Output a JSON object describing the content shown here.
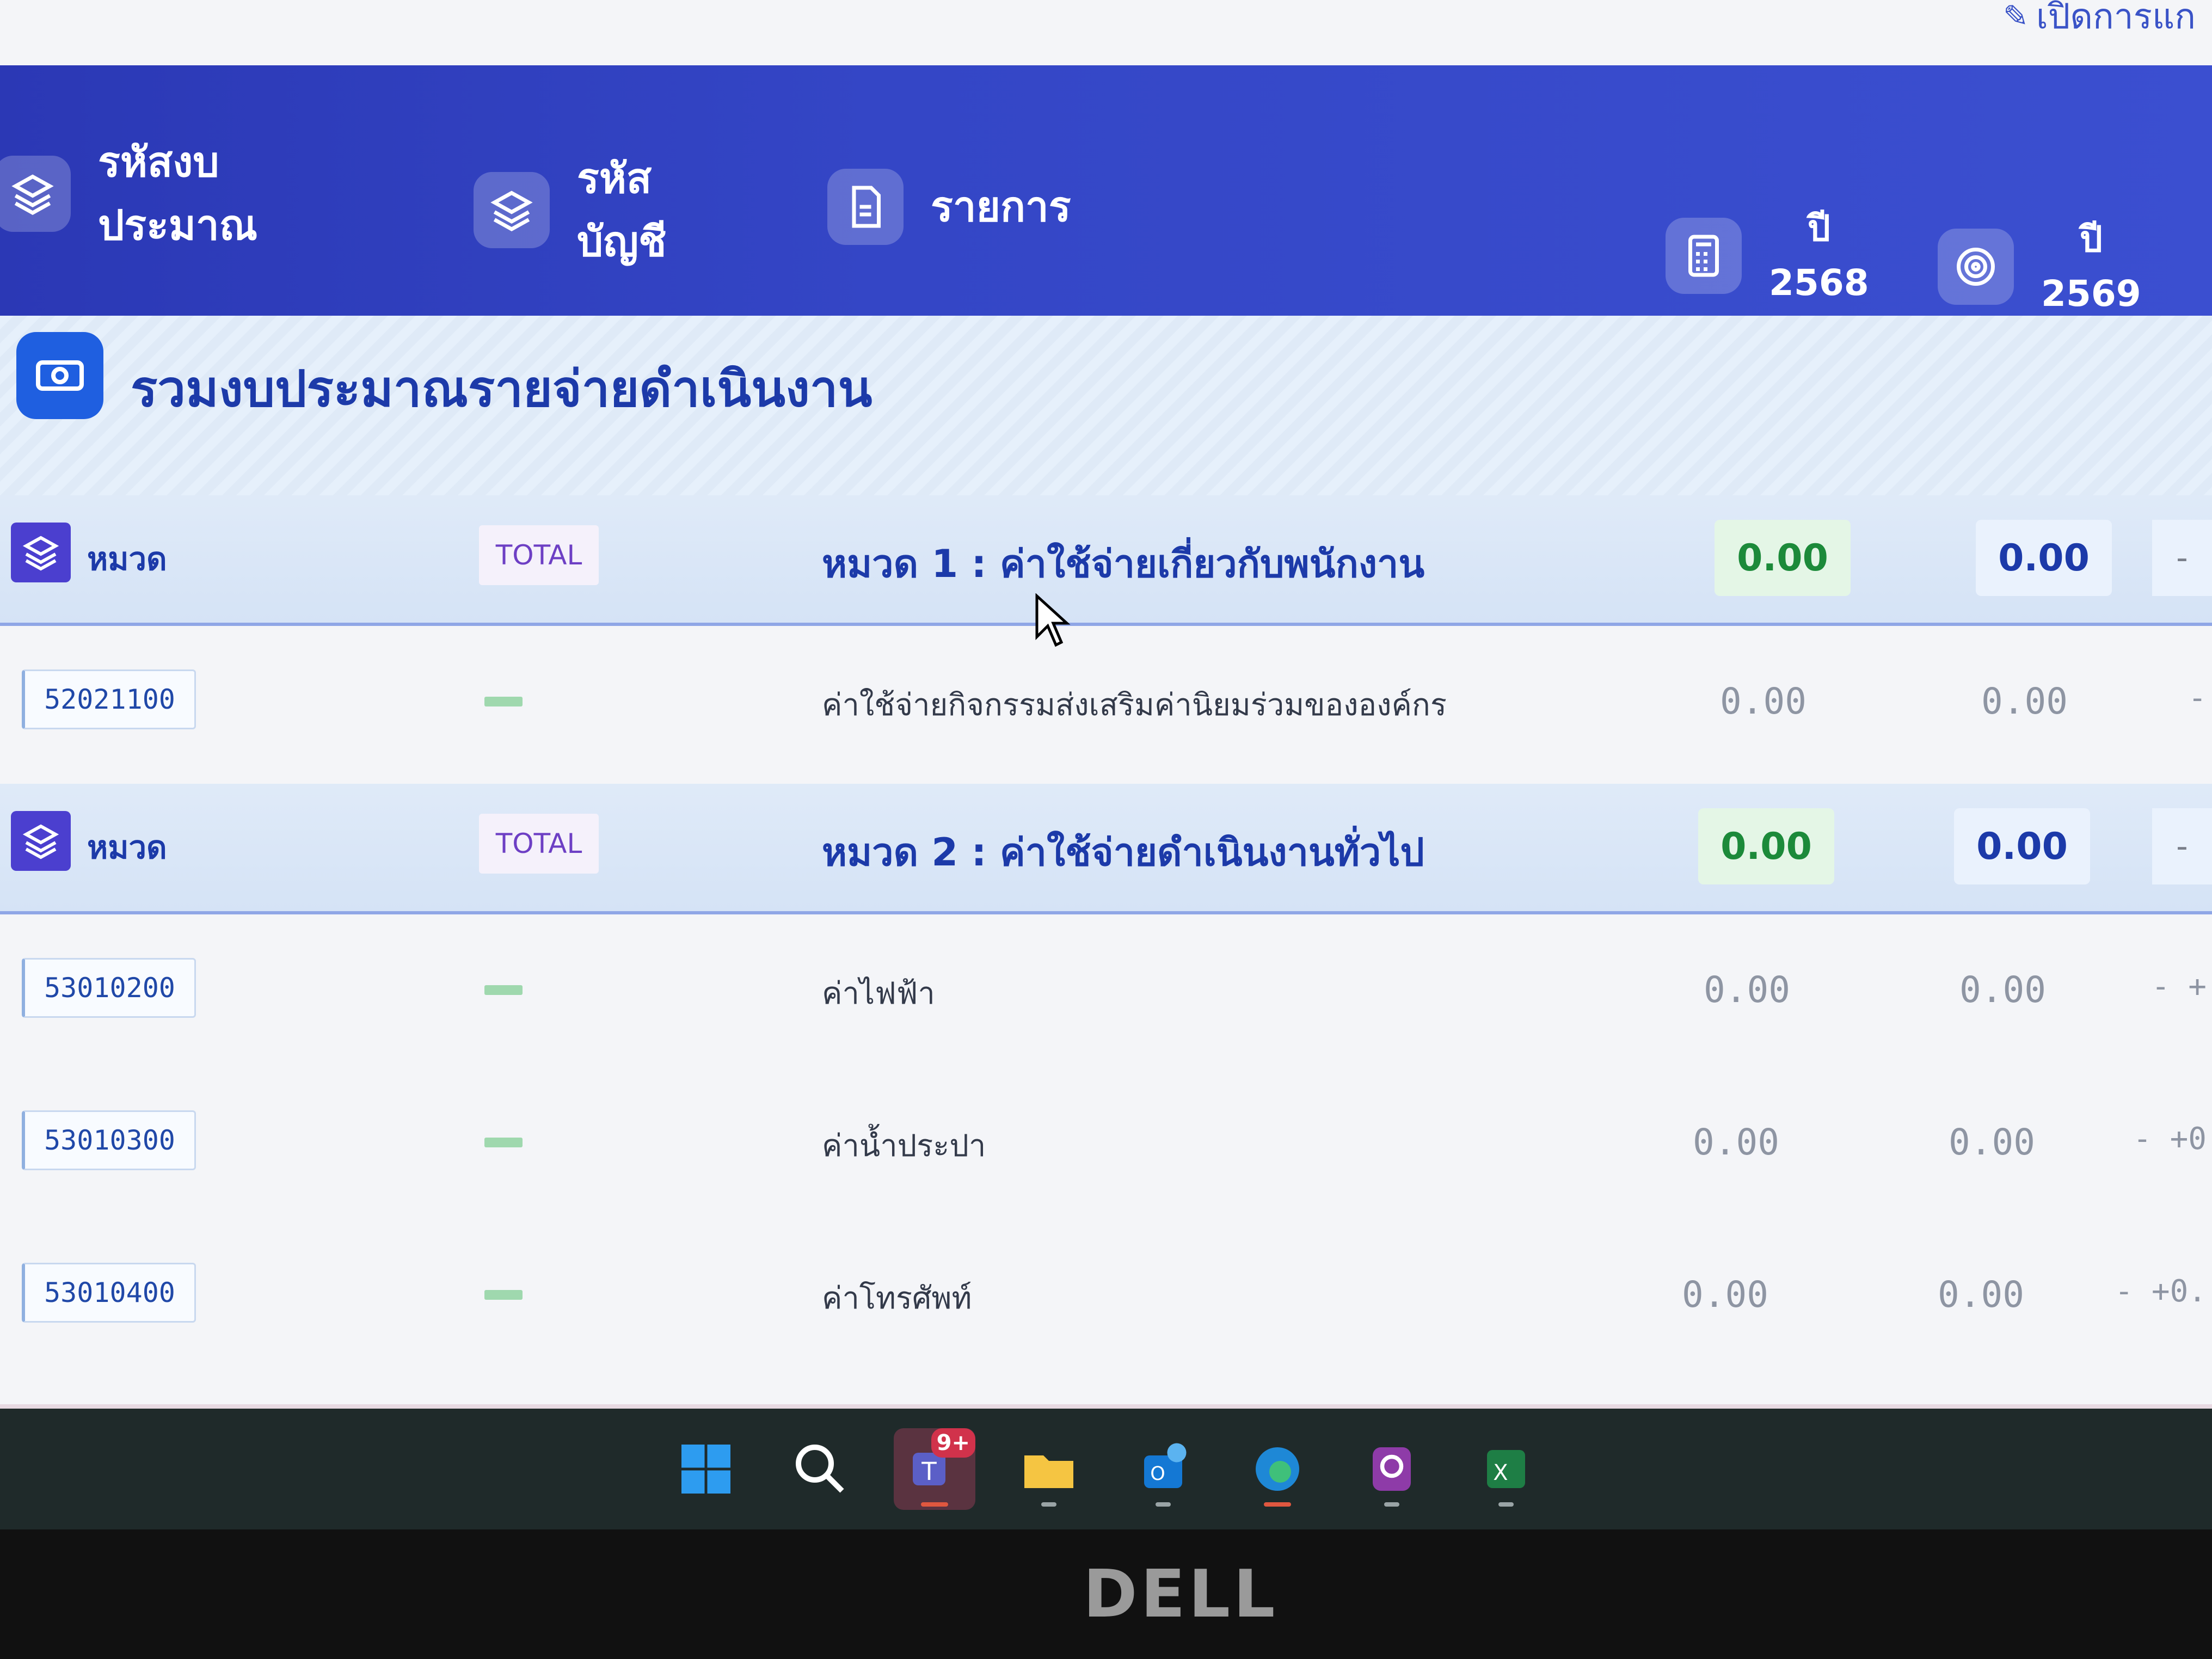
{
  "top_link": {
    "label": "เปิดการแก"
  },
  "header": {
    "columns": [
      {
        "label": "รหัสงบ ประมาณ",
        "icon": "layers-icon"
      },
      {
        "label": "รหัส บัญชี",
        "icon": "layers-icon"
      },
      {
        "label": "รายการ",
        "icon": "document-icon"
      }
    ],
    "years": [
      {
        "label": "ปี",
        "year": "2568",
        "icon": "calculator-icon"
      },
      {
        "label": "ปี",
        "year": "2569",
        "icon": "target-icon"
      }
    ]
  },
  "section": {
    "title": "รวมงบประมาณรายจ่ายดำเนินงาน",
    "icon": "money-icon"
  },
  "categories": [
    {
      "label": "หมวด",
      "badge": "TOTAL",
      "title": "หมวด 1 : ค่าใช้จ่ายเกี่ยวกับพนักงาน",
      "value_2568": "0.00",
      "value_2569": "0.00",
      "end": "-",
      "items": [
        {
          "code": "52021100",
          "name": "ค่าใช้จ่ายกิจกรรมส่งเสริมค่านิยมร่วมขององค์กร",
          "value_2568": "0.00",
          "value_2569": "0.00",
          "change": "-"
        }
      ]
    },
    {
      "label": "หมวด",
      "badge": "TOTAL",
      "title": "หมวด 2 : ค่าใช้จ่ายดำเนินงานทั่วไป",
      "value_2568": "0.00",
      "value_2569": "0.00",
      "end": "-",
      "items": [
        {
          "code": "53010200",
          "name": "ค่าไฟฟ้า",
          "value_2568": "0.00",
          "value_2569": "0.00",
          "change": "- +"
        },
        {
          "code": "53010300",
          "name": "ค่าน้ำประปา",
          "value_2568": "0.00",
          "value_2569": "0.00",
          "change": "- +0"
        },
        {
          "code": "53010400",
          "name": "ค่าโทรศัพท์",
          "value_2568": "0.00",
          "value_2569": "0.00",
          "change": "- +0."
        }
      ]
    }
  ],
  "taskbar": {
    "apps": [
      {
        "name": "windows-start-icon",
        "badge": ""
      },
      {
        "name": "search-icon",
        "badge": ""
      },
      {
        "name": "teams-icon",
        "badge": "9+"
      },
      {
        "name": "file-explorer-icon",
        "badge": ""
      },
      {
        "name": "outlook-icon",
        "badge": ""
      },
      {
        "name": "edge-icon",
        "badge": ""
      },
      {
        "name": "pdf-icon",
        "badge": ""
      },
      {
        "name": "excel-icon",
        "badge": ""
      }
    ]
  },
  "monitor": {
    "brand": "DELL"
  },
  "colors": {
    "header": "#3446c6",
    "accent_green": "#1c8a3a",
    "accent_blue": "#1c3aa9",
    "badge_purple": "#6d3fc4"
  }
}
